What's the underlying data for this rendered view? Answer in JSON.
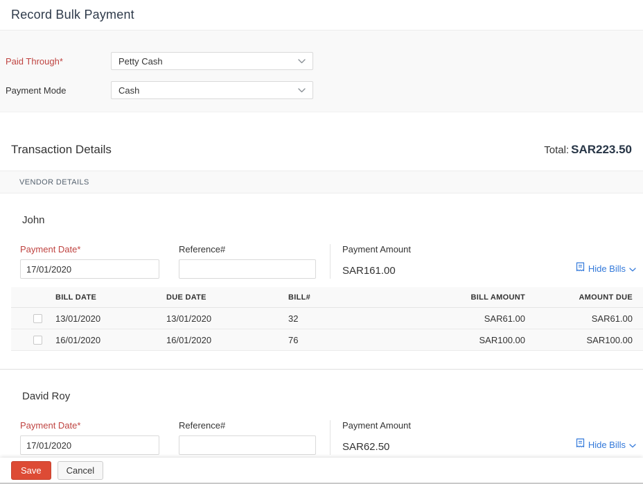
{
  "header": {
    "title": "Record Bulk Payment"
  },
  "form": {
    "paid_through": {
      "label": "Paid Through*",
      "value": "Petty Cash"
    },
    "payment_mode": {
      "label": "Payment Mode",
      "value": "Cash"
    }
  },
  "transaction": {
    "heading": "Transaction Details",
    "total_label": "Total:",
    "total_value": "SAR223.50"
  },
  "vendor_section": {
    "header": "VENDOR DETAILS"
  },
  "labels": {
    "payment_date": "Payment Date*",
    "reference": "Reference#",
    "payment_amount": "Payment Amount",
    "hide_bills": "Hide Bills"
  },
  "table_headers": {
    "bill_date": "BILL DATE",
    "due_date": "DUE DATE",
    "bill_no": "BILL#",
    "bill_amount": "BILL AMOUNT",
    "amount_due": "AMOUNT DUE"
  },
  "vendors": [
    {
      "name": "John",
      "payment_date": "17/01/2020",
      "reference": "",
      "payment_amount": "SAR161.00",
      "bills": [
        {
          "bill_date": "13/01/2020",
          "due_date": "13/01/2020",
          "bill_no": "32",
          "bill_amount": "SAR61.00",
          "amount_due": "SAR61.00"
        },
        {
          "bill_date": "16/01/2020",
          "due_date": "16/01/2020",
          "bill_no": "76",
          "bill_amount": "SAR100.00",
          "amount_due": "SAR100.00"
        }
      ]
    },
    {
      "name": "David Roy",
      "payment_date": "17/01/2020",
      "reference": "",
      "payment_amount": "SAR62.50"
    }
  ],
  "footer": {
    "save_label": "Save",
    "cancel_label": "Cancel"
  },
  "icons": {
    "select_chevron": "chevron-down-icon",
    "hide_bills_doc": "bill-receipt-icon",
    "hide_bills_chevron": "chevron-down-icon"
  },
  "colors": {
    "required_label_red": "#bf4340",
    "link_blue": "#3379da",
    "save_button_red": "#dd4b35",
    "section_gray": "#f9f9f9"
  }
}
